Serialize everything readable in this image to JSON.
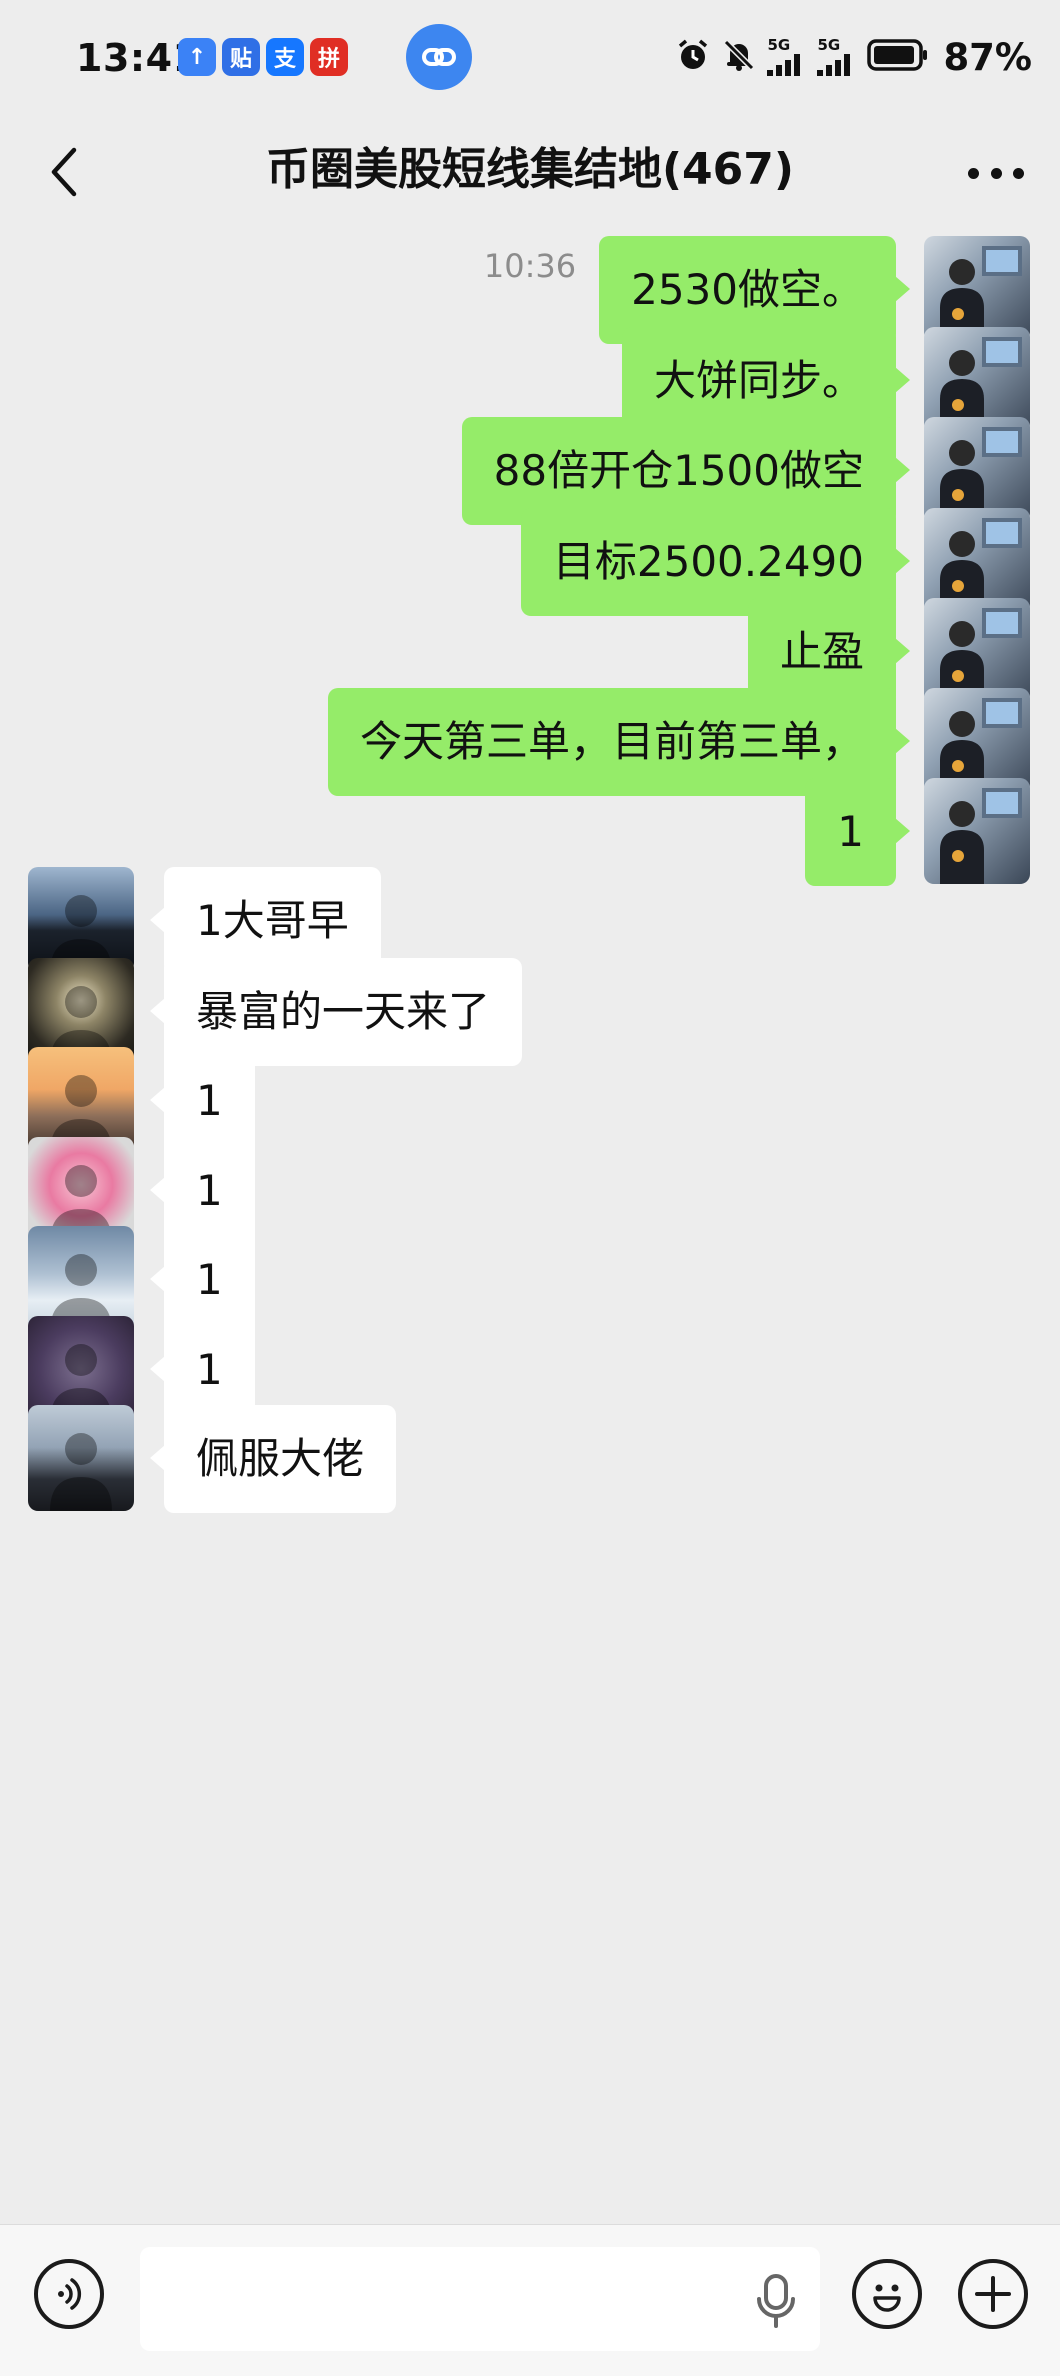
{
  "status_bar": {
    "time": "13:41",
    "app_icons": [
      {
        "name": "upload-app-icon",
        "glyph": "↑",
        "color": "#3b82f6"
      },
      {
        "name": "tieba-app-icon",
        "glyph": "贴",
        "color": "#2f6fe6"
      },
      {
        "name": "alipay-app-icon",
        "glyph": "支",
        "color": "#1677ff"
      },
      {
        "name": "pinduoduo-app-icon",
        "glyph": "拼",
        "color": "#e02e24"
      }
    ],
    "net1": "5G",
    "net2": "5G",
    "battery": "87%"
  },
  "nav": {
    "title": "币圈美股短线集结地(467)"
  },
  "chat": {
    "time_separator": "10:36",
    "messages": [
      {
        "side": "me",
        "text": "2530做空。",
        "avatar": "av-trader"
      },
      {
        "side": "me",
        "text": "大饼同步。",
        "avatar": "av-trader"
      },
      {
        "side": "me",
        "text": "88倍开仓1500做空",
        "avatar": "av-trader"
      },
      {
        "side": "me",
        "text": "目标2500.2490",
        "avatar": "av-trader"
      },
      {
        "side": "me",
        "text": "止盈",
        "avatar": "av-trader"
      },
      {
        "side": "me",
        "text": "今天第三单，目前第三单，",
        "avatar": "av-trader"
      },
      {
        "side": "me",
        "text": "1",
        "avatar": "av-trader"
      },
      {
        "side": "other",
        "text": "1大哥早",
        "avatar": "av-car"
      },
      {
        "side": "other",
        "text": "暴富的一天来了",
        "avatar": "av-fig"
      },
      {
        "side": "other",
        "text": "1",
        "avatar": "av-sunset"
      },
      {
        "side": "other",
        "text": "1",
        "avatar": "av-pink"
      },
      {
        "side": "other",
        "text": "1",
        "avatar": "av-snow"
      },
      {
        "side": "other",
        "text": "1",
        "avatar": "av-coin"
      },
      {
        "side": "other",
        "text": "佩服大佬",
        "avatar": "av-man"
      }
    ]
  },
  "input_bar": {
    "value": "",
    "placeholder": ""
  }
}
